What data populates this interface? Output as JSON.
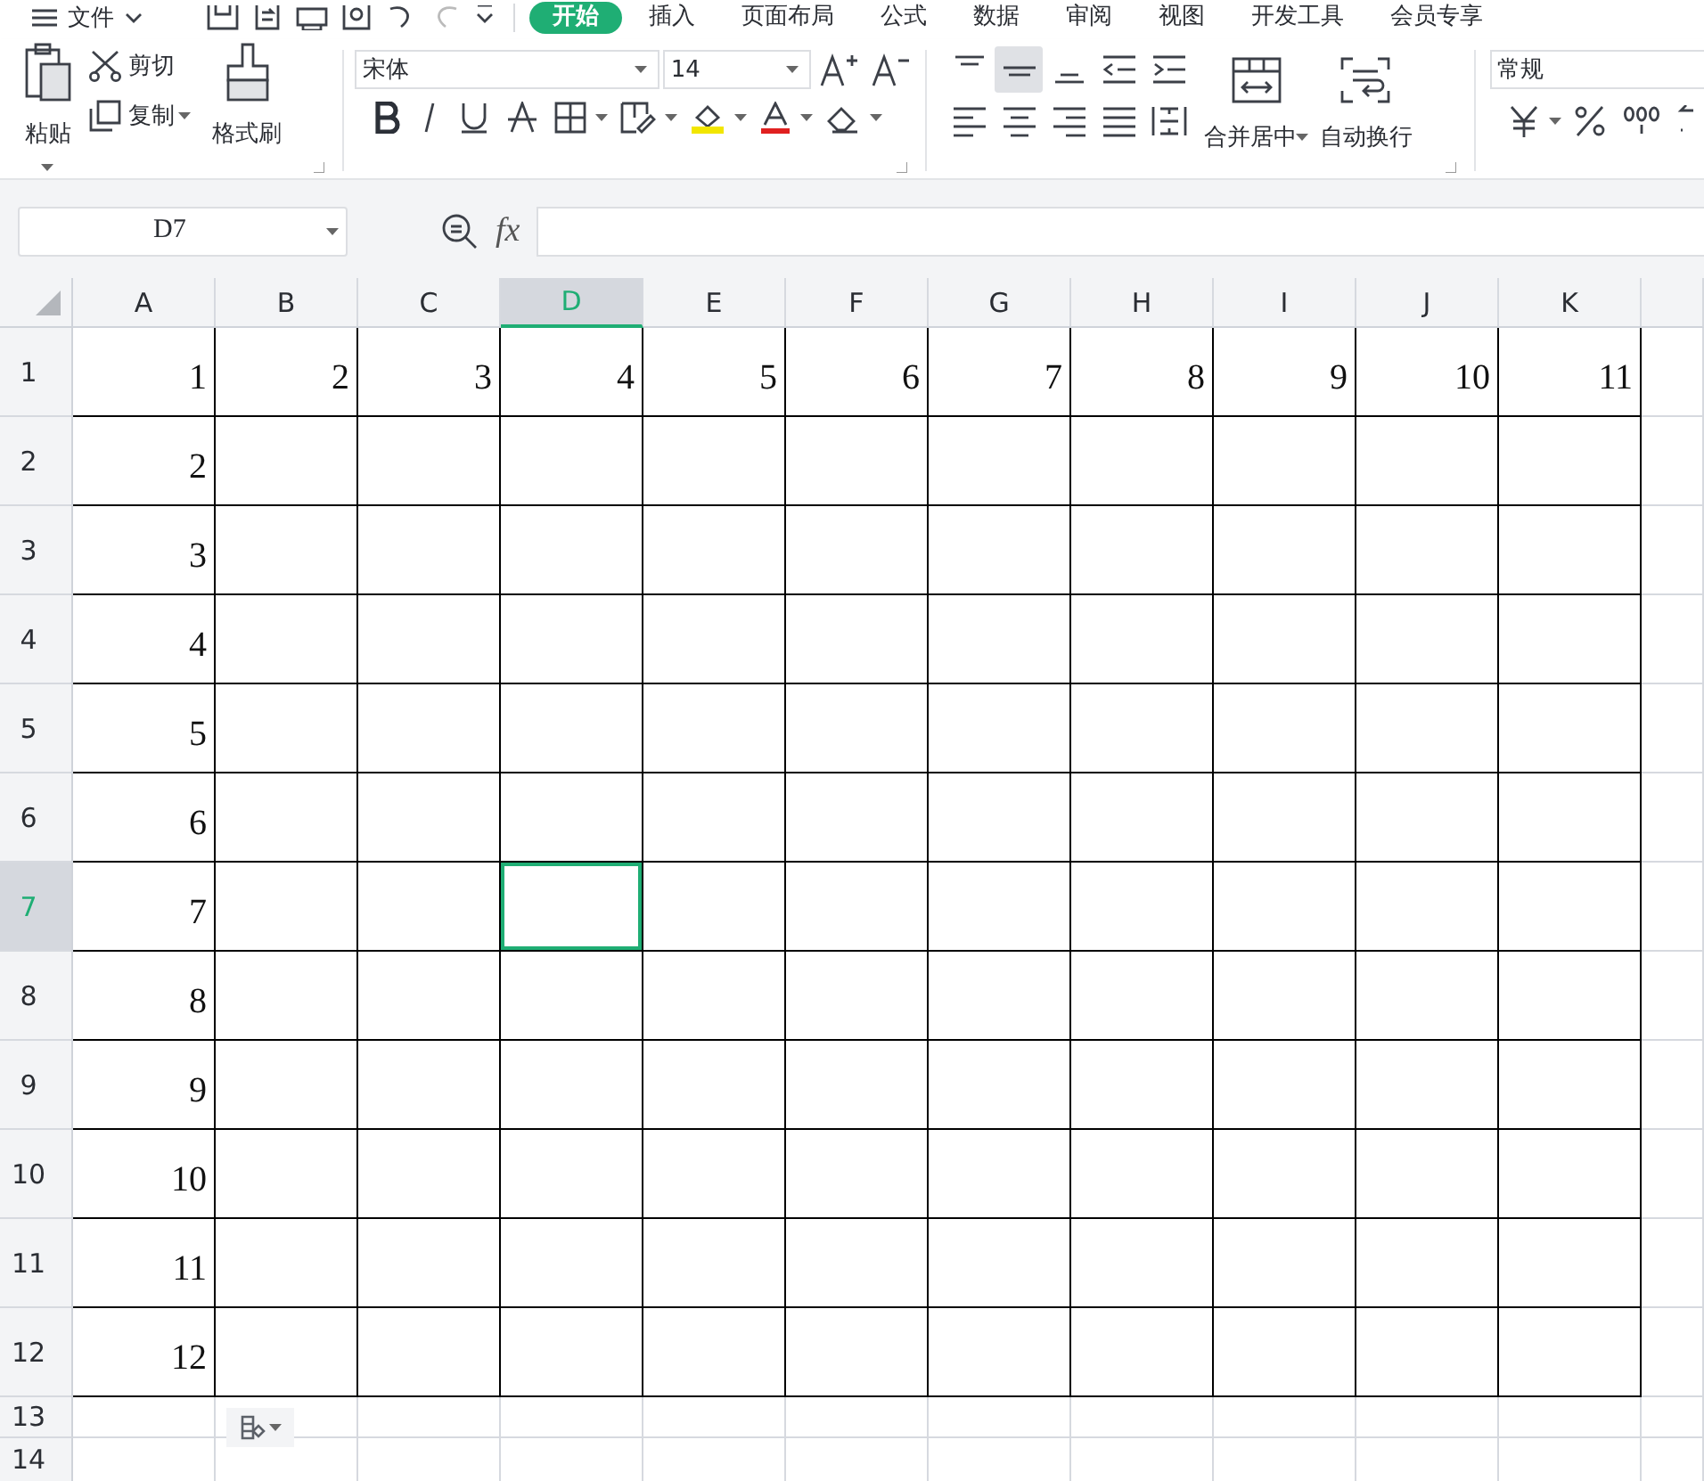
{
  "menu": {
    "file_label": "文件",
    "tabs": [
      {
        "label": "开始",
        "selected": true
      },
      {
        "label": "插入",
        "selected": false
      },
      {
        "label": "页面布局",
        "selected": false
      },
      {
        "label": "公式",
        "selected": false
      },
      {
        "label": "数据",
        "selected": false
      },
      {
        "label": "审阅",
        "selected": false
      },
      {
        "label": "视图",
        "selected": false
      },
      {
        "label": "开发工具",
        "selected": false
      },
      {
        "label": "会员专享",
        "selected": false
      }
    ]
  },
  "ribbon": {
    "clipboard": {
      "paste": "粘贴",
      "cut": "剪切",
      "copy": "复制",
      "format_painter": "格式刷"
    },
    "font": {
      "font_name": "宋体",
      "font_size": "14"
    },
    "alignment": {
      "merge": "合并居中",
      "wrap": "自动换行",
      "middle_align_selected": true
    },
    "number": {
      "format": "常规"
    }
  },
  "formula_bar": {
    "name_box": "D7",
    "formula": "fx"
  },
  "columns": [
    {
      "label": "A",
      "selected": false
    },
    {
      "label": "B",
      "selected": false
    },
    {
      "label": "C",
      "selected": false
    },
    {
      "label": "D",
      "selected": true
    },
    {
      "label": "E",
      "selected": false
    },
    {
      "label": "F",
      "selected": false
    },
    {
      "label": "G",
      "selected": false
    },
    {
      "label": "H",
      "selected": false
    },
    {
      "label": "I",
      "selected": false
    },
    {
      "label": "J",
      "selected": false
    },
    {
      "label": "K",
      "selected": false
    }
  ],
  "rows": [
    {
      "header": "1",
      "selected": false,
      "bordered": true,
      "cells": [
        "1",
        "2",
        "3",
        "4",
        "5",
        "6",
        "7",
        "8",
        "9",
        "10",
        "11"
      ]
    },
    {
      "header": "2",
      "selected": false,
      "bordered": true,
      "cells": [
        "2"
      ]
    },
    {
      "header": "3",
      "selected": false,
      "bordered": true,
      "cells": [
        "3"
      ]
    },
    {
      "header": "4",
      "selected": false,
      "bordered": true,
      "cells": [
        "4"
      ]
    },
    {
      "header": "5",
      "selected": false,
      "bordered": true,
      "cells": [
        "5"
      ]
    },
    {
      "header": "6",
      "selected": false,
      "bordered": true,
      "cells": [
        "6"
      ]
    },
    {
      "header": "7",
      "selected": true,
      "bordered": true,
      "cells": [
        "7"
      ]
    },
    {
      "header": "8",
      "selected": false,
      "bordered": true,
      "cells": [
        "8"
      ]
    },
    {
      "header": "9",
      "selected": false,
      "bordered": true,
      "cells": [
        "9"
      ]
    },
    {
      "header": "10",
      "selected": false,
      "bordered": true,
      "cells": [
        "10"
      ]
    },
    {
      "header": "11",
      "selected": false,
      "bordered": true,
      "cells": [
        "11"
      ]
    },
    {
      "header": "12",
      "selected": false,
      "bordered": true,
      "cells": [
        "12"
      ]
    },
    {
      "header": "13",
      "selected": false,
      "bordered": false
    },
    {
      "header": "14",
      "selected": false,
      "bordered": false
    }
  ]
}
